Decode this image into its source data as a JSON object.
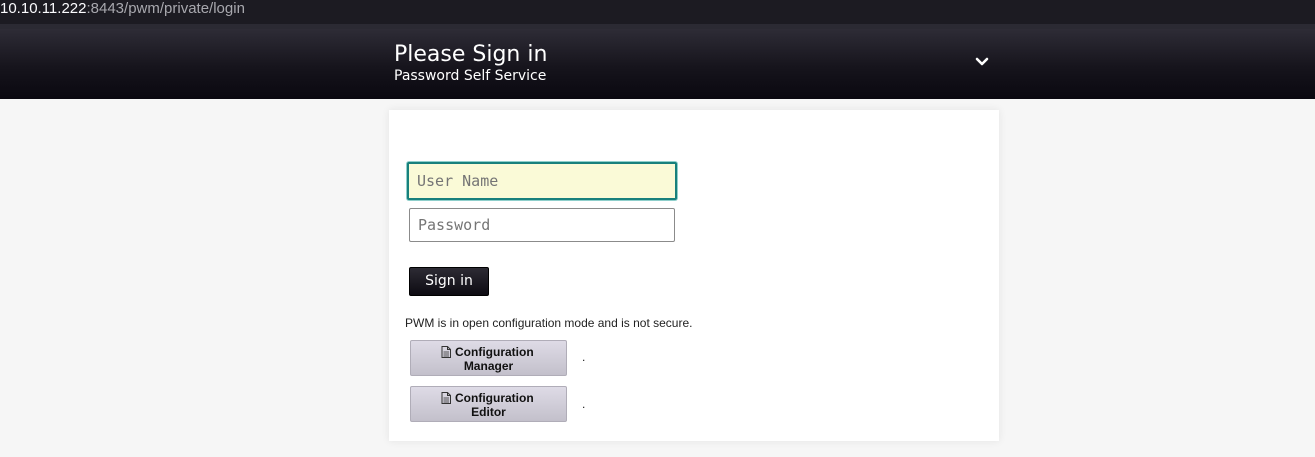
{
  "browser": {
    "url_host": "10.10.11.222",
    "url_path": ":8443/pwm/private/login"
  },
  "header": {
    "title": "Please Sign in",
    "subtitle": "Password Self Service",
    "toggle_icon": "chevron-down-icon"
  },
  "login": {
    "username_placeholder": "User Name",
    "username_value": "",
    "password_placeholder": "Password",
    "password_value": "",
    "signin_label": "Sign in"
  },
  "config": {
    "notice": "PWM is in open configuration mode and is not secure.",
    "manager_line1": "Configuration",
    "manager_line2": "Manager",
    "editor_line1": "Configuration",
    "editor_line2": "Editor",
    "dot": ".",
    "button_icon": "document-icon"
  },
  "colors": {
    "header_bg": "#16141c",
    "focus_border": "#18807c",
    "focus_fill": "#fafad7",
    "config_button": "#cfccd7"
  }
}
